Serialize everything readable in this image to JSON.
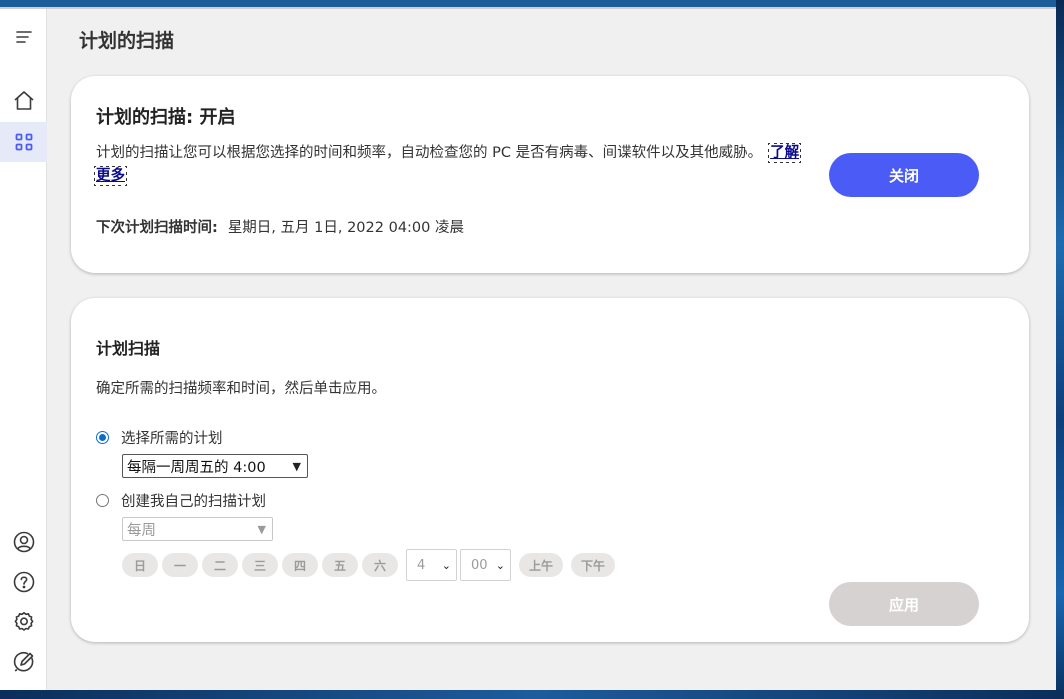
{
  "sidebar": {
    "menu_icon": "hamburger-menu-icon",
    "top_items": [
      {
        "icon": "home-icon"
      },
      {
        "icon": "apps-grid-icon",
        "active": true
      }
    ],
    "bottom_items": [
      {
        "icon": "account-icon"
      },
      {
        "icon": "help-icon"
      },
      {
        "icon": "settings-icon"
      },
      {
        "icon": "feedback-icon"
      }
    ]
  },
  "page": {
    "title": "计划的扫描"
  },
  "status_card": {
    "title": "计划的扫描: 开启",
    "description": "计划的扫描让您可以根据您选择的时间和频率，自动检查您的 PC 是否有病毒、间谍软件以及其他威胁。",
    "learn_more": "了解更多",
    "next_scan_label": "下次计划扫描时间:",
    "next_scan_value": "星期日, 五月 1日, 2022 04:00 凌晨",
    "close_button": "关闭",
    "accent_color": "#4a5cf5"
  },
  "schedule_card": {
    "title": "计划扫描",
    "description": "确定所需的扫描频率和时间，然后单击应用。",
    "option_preset": {
      "label": "选择所需的计划",
      "selected": true,
      "select_value": "每隔一周周五的 4:00"
    },
    "option_custom": {
      "label": "创建我自己的扫描计划",
      "selected": false,
      "frequency_value": "每周",
      "days": [
        "日",
        "一",
        "二",
        "三",
        "四",
        "五",
        "六"
      ],
      "hour": "4",
      "minute": "00",
      "am": "上午",
      "pm": "下午"
    },
    "apply_button": "应用"
  }
}
